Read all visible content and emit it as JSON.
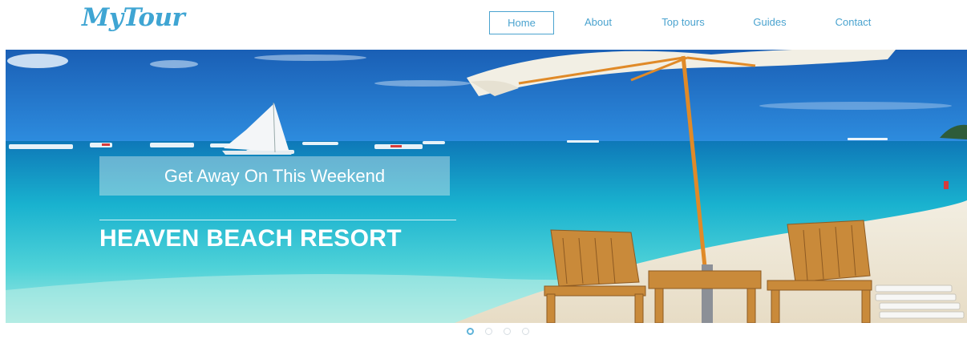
{
  "brand": {
    "logo_text": "MyTour",
    "color": "#3fa5d3"
  },
  "nav": {
    "items": [
      {
        "label": "Home",
        "active": true
      },
      {
        "label": "About",
        "active": false
      },
      {
        "label": "Top tours",
        "active": false
      },
      {
        "label": "Guides",
        "active": false
      },
      {
        "label": "Contact",
        "active": false
      }
    ]
  },
  "hero": {
    "tagline": "Get Away On This Weekend",
    "title": "HEAVEN BEACH RESORT"
  },
  "carousel": {
    "slide_count": 4,
    "active_index": 0
  }
}
